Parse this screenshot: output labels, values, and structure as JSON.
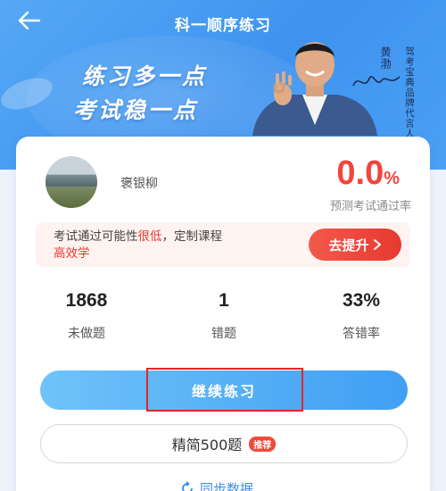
{
  "header": {
    "title": "科一顺序练习",
    "back_icon": "arrow-left-icon"
  },
  "banner": {
    "slogan_line1": "练习多一点",
    "slogan_line2": "考试稳一点",
    "spokesman_name": "黄渤",
    "spokesman_title": "驾考宝典品牌代言人"
  },
  "profile": {
    "name": "褒银柳",
    "pass_rate_value": "0.0",
    "pass_rate_unit": "%",
    "pass_rate_label": "预测考试通过率"
  },
  "tip": {
    "text_before": "考试通过可能性",
    "text_highlight": "很低",
    "text_after": "，定制课程",
    "text_highlight2": "高效学",
    "button_label": "去提升",
    "button_icon": "chevron-right-icon"
  },
  "stats": [
    {
      "value": "1868",
      "label": "未做题"
    },
    {
      "value": "1",
      "label": "错题"
    },
    {
      "value": "33%",
      "label": "答错率"
    }
  ],
  "actions": {
    "continue_label": "继续练习",
    "simplified_label": "精简500题",
    "simplified_badge": "推荐",
    "sync_label": "同步数据"
  },
  "colors": {
    "brand_blue": "#3f9ff3",
    "accent_red": "#f2453d"
  }
}
